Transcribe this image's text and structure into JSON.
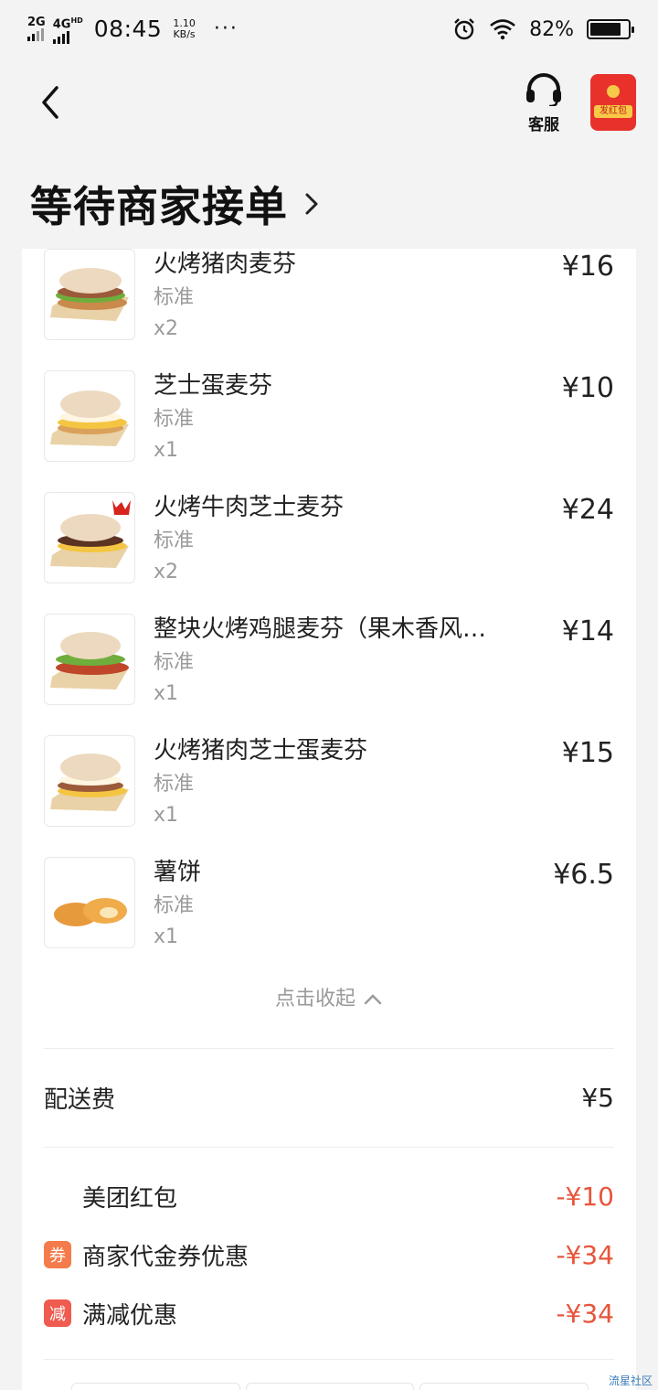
{
  "status": {
    "network_a": "2G",
    "network_b": "4G",
    "network_b_sup": "HD",
    "time": "08:45",
    "speed_value": "1.10",
    "speed_unit": "KB/s",
    "more": "···",
    "battery": "82%",
    "battery_level": 0.82
  },
  "header": {
    "service_label": "客服",
    "redpack_label": "发红包",
    "title": "等待商家接单"
  },
  "items": [
    {
      "name": "火烤猪肉麦芬",
      "spec": "标准",
      "qty": "x2",
      "price": "¥16"
    },
    {
      "name": "芝士蛋麦芬",
      "spec": "标准",
      "qty": "x1",
      "price": "¥10"
    },
    {
      "name": "火烤牛肉芝士麦芬",
      "spec": "标准",
      "qty": "x2",
      "price": "¥24"
    },
    {
      "name": "整块火烤鸡腿麦芬（果木香风…",
      "spec": "标准",
      "qty": "x1",
      "price": "¥14"
    },
    {
      "name": "火烤猪肉芝士蛋麦芬",
      "spec": "标准",
      "qty": "x1",
      "price": "¥15"
    },
    {
      "name": "薯饼",
      "spec": "标准",
      "qty": "x1",
      "price": "¥6.5"
    }
  ],
  "collapse_label": "点击收起",
  "delivery": {
    "label": "配送费",
    "value": "¥5"
  },
  "discounts": [
    {
      "label": "美团红包",
      "value": "-¥10",
      "badge": ""
    },
    {
      "label": "商家代金券优惠",
      "value": "-¥34",
      "badge": "券",
      "badge_color": "#f47b4b"
    },
    {
      "label": "满减优惠",
      "value": "-¥34",
      "badge": "减",
      "badge_color": "#ef5b4f"
    }
  ],
  "watermark": "流星社区",
  "colors": {
    "accent_red": "#e8553a",
    "redpack_bg": "#e8312b",
    "coupon_badge": "#f47b4b",
    "reduce_badge": "#ef5b4f"
  }
}
